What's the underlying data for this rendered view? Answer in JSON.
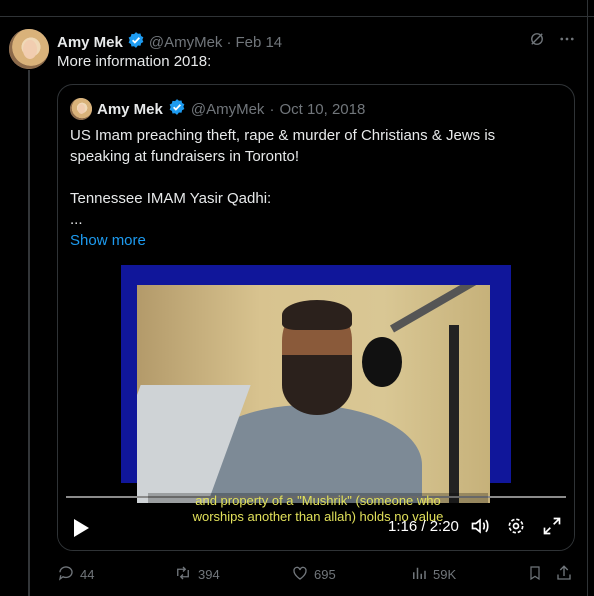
{
  "tweet": {
    "author_name": "Amy Mek",
    "handle": "@AmyMek",
    "separator": "·",
    "date": "Feb 14",
    "text": "More information 2018:"
  },
  "quote": {
    "author_name": "Amy Mek",
    "handle": "@AmyMek",
    "separator": "·",
    "date": "Oct 10, 2018",
    "text_line1": "US Imam preaching theft, rape & murder of Christians & Jews is speaking at fundraisers in Toronto!",
    "text_line2": "Tennessee IMAM Yasir Qadhi:",
    "text_line3": "...",
    "show_more": "Show more",
    "video": {
      "caption_line1": "and property of a \"Mushrik\" (someone who",
      "caption_line2": "worships another than allah) holds no value",
      "time": "1:16 / 2:20",
      "progress": 0.0
    }
  },
  "actions": {
    "replies": "44",
    "reposts": "394",
    "likes": "695",
    "views": "59K"
  },
  "colors": {
    "accent": "#1d9bf0",
    "muted": "#71767b",
    "caption": "#e1e05a"
  },
  "icons": [
    "verified-badge-icon",
    "grok-icon",
    "more-icon",
    "play-icon",
    "volume-icon",
    "settings-icon",
    "fullscreen-icon",
    "reply-icon",
    "repost-icon",
    "like-icon",
    "views-icon",
    "bookmark-icon",
    "share-icon"
  ]
}
